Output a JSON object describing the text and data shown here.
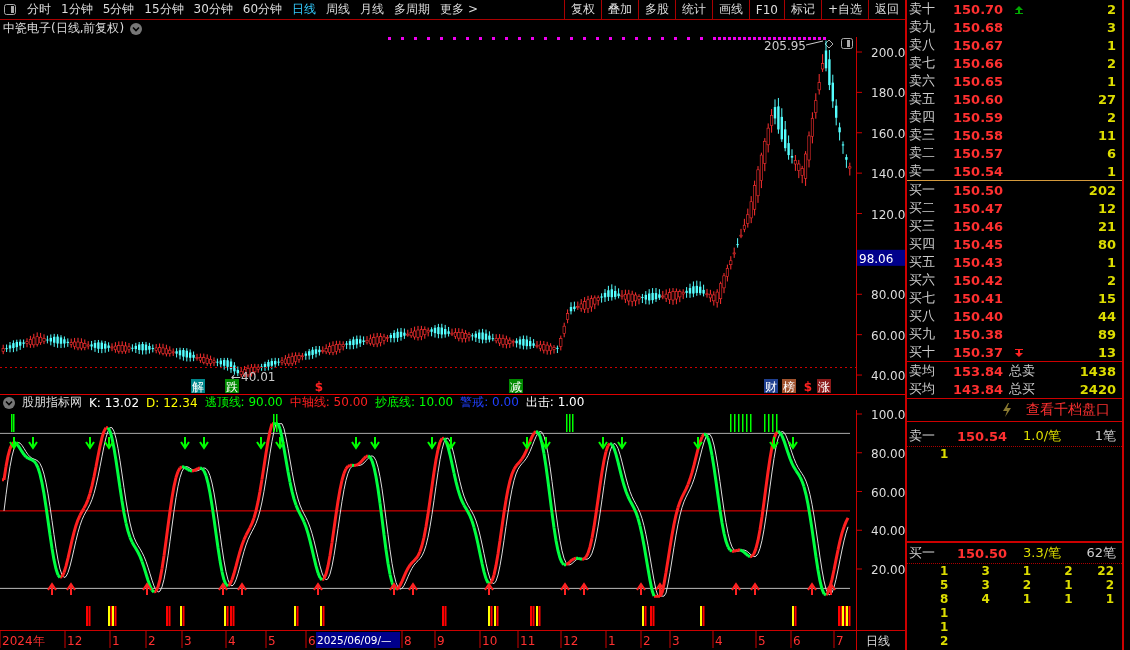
{
  "toolbar": {
    "periods": [
      {
        "label": "分时",
        "selected": false
      },
      {
        "label": "1分钟",
        "selected": false
      },
      {
        "label": "5分钟",
        "selected": false
      },
      {
        "label": "15分钟",
        "selected": false
      },
      {
        "label": "30分钟",
        "selected": false
      },
      {
        "label": "60分钟",
        "selected": false
      },
      {
        "label": "日线",
        "selected": true
      },
      {
        "label": "周线",
        "selected": false
      },
      {
        "label": "月线",
        "selected": false
      },
      {
        "label": "多周期",
        "selected": false
      },
      {
        "label": "更多 >",
        "selected": false
      }
    ],
    "actions": [
      "复权",
      "叠加",
      "多股",
      "统计",
      "画线",
      "F10",
      "标记",
      "+自选",
      "返回"
    ]
  },
  "main_chart": {
    "title": "中瓷电子(日线,前复权)",
    "price_labels": [
      "200.0",
      "180.0",
      "160.0",
      "140.0",
      "120.0",
      "80.00",
      "60.00",
      "40.00"
    ],
    "cursor_price": "98.06",
    "high_mark": "205.95",
    "low_mark": "←40.01",
    "events": [
      {
        "kind": "badge",
        "label": "解",
        "color": "#00868b"
      },
      {
        "kind": "badge",
        "label": "跌",
        "color": "#008a00"
      },
      {
        "kind": "symbol",
        "label": "$",
        "color": "#ff2020"
      },
      {
        "kind": "badge",
        "label": "减",
        "color": "#008a00"
      },
      {
        "kind": "badge",
        "label": "财",
        "color": "#1f3f8f"
      },
      {
        "kind": "badge",
        "label": "榜",
        "color": "#a0522d"
      },
      {
        "kind": "symbol",
        "label": "$",
        "color": "#ff2020"
      },
      {
        "kind": "badge",
        "label": "涨",
        "color": "#8b1a1a"
      }
    ]
  },
  "indicator": {
    "name": "股朋指标网",
    "params": [
      {
        "label": "K: 13.02",
        "color": "#ffffff"
      },
      {
        "label": "D: 12.34",
        "color": "#ffff00"
      },
      {
        "label": "逃顶线: 90.00",
        "color": "#00ff00"
      },
      {
        "label": "中轴线: 50.00",
        "color": "#ff2020"
      },
      {
        "label": "抄底线: 10.00",
        "color": "#00ff00"
      },
      {
        "label": "警戒: 0.00",
        "color": "#2040ff"
      },
      {
        "label": "出击: 1.00",
        "color": "#ffffff"
      }
    ],
    "axis_labels": [
      "100.0",
      "80.00",
      "60.00",
      "40.00",
      "20.00"
    ]
  },
  "date_axis": {
    "labels": [
      "2024年",
      "12",
      "1",
      "2",
      "3",
      "4",
      "5",
      "6",
      "2025/06/09/—",
      "8",
      "9",
      "10",
      "11",
      "12",
      "1",
      "2",
      "3",
      "4",
      "5",
      "6",
      "7"
    ],
    "period": "日线"
  },
  "order_book": {
    "asks": [
      {
        "level": "卖十",
        "price": "150.70",
        "volume": "2"
      },
      {
        "level": "卖九",
        "price": "150.68",
        "volume": "3"
      },
      {
        "level": "卖八",
        "price": "150.67",
        "volume": "1"
      },
      {
        "level": "卖七",
        "price": "150.66",
        "volume": "2"
      },
      {
        "level": "卖六",
        "price": "150.65",
        "volume": "1"
      },
      {
        "level": "卖五",
        "price": "150.60",
        "volume": "27"
      },
      {
        "level": "卖四",
        "price": "150.59",
        "volume": "2"
      },
      {
        "level": "卖三",
        "price": "150.58",
        "volume": "11"
      },
      {
        "level": "卖二",
        "price": "150.57",
        "volume": "6"
      },
      {
        "level": "卖一",
        "price": "150.54",
        "volume": "1"
      }
    ],
    "bids": [
      {
        "level": "买一",
        "price": "150.50",
        "volume": "202"
      },
      {
        "level": "买二",
        "price": "150.47",
        "volume": "12"
      },
      {
        "level": "买三",
        "price": "150.46",
        "volume": "21"
      },
      {
        "level": "买四",
        "price": "150.45",
        "volume": "80"
      },
      {
        "level": "买五",
        "price": "150.43",
        "volume": "1"
      },
      {
        "level": "买六",
        "price": "150.42",
        "volume": "2"
      },
      {
        "level": "买七",
        "price": "150.41",
        "volume": "15"
      },
      {
        "level": "买八",
        "price": "150.40",
        "volume": "44"
      },
      {
        "level": "买九",
        "price": "150.38",
        "volume": "89"
      },
      {
        "level": "买十",
        "price": "150.37",
        "volume": "13"
      }
    ],
    "summary": [
      {
        "label": "卖均",
        "price": "153.84",
        "total_label": "总卖",
        "total": "1438"
      },
      {
        "label": "买均",
        "price": "143.84",
        "total_label": "总买",
        "total": "2420"
      }
    ],
    "depth_link": "查看千档盘口"
  },
  "queues": [
    {
      "level": "卖一",
      "price": "150.54",
      "average": "1.0/笔",
      "count": "1笔",
      "rows": [
        [
          "1"
        ]
      ]
    },
    {
      "level": "买一",
      "price": "150.50",
      "average": "3.3/笔",
      "count": "62笔",
      "rows": [
        [
          "1",
          "3",
          "1",
          "2",
          "22"
        ],
        [
          "5",
          "3",
          "2",
          "1",
          "2"
        ],
        [
          "8",
          "4",
          "1",
          "1",
          "1"
        ],
        [
          "1"
        ],
        [
          "1"
        ],
        [
          "2"
        ]
      ]
    }
  ]
}
